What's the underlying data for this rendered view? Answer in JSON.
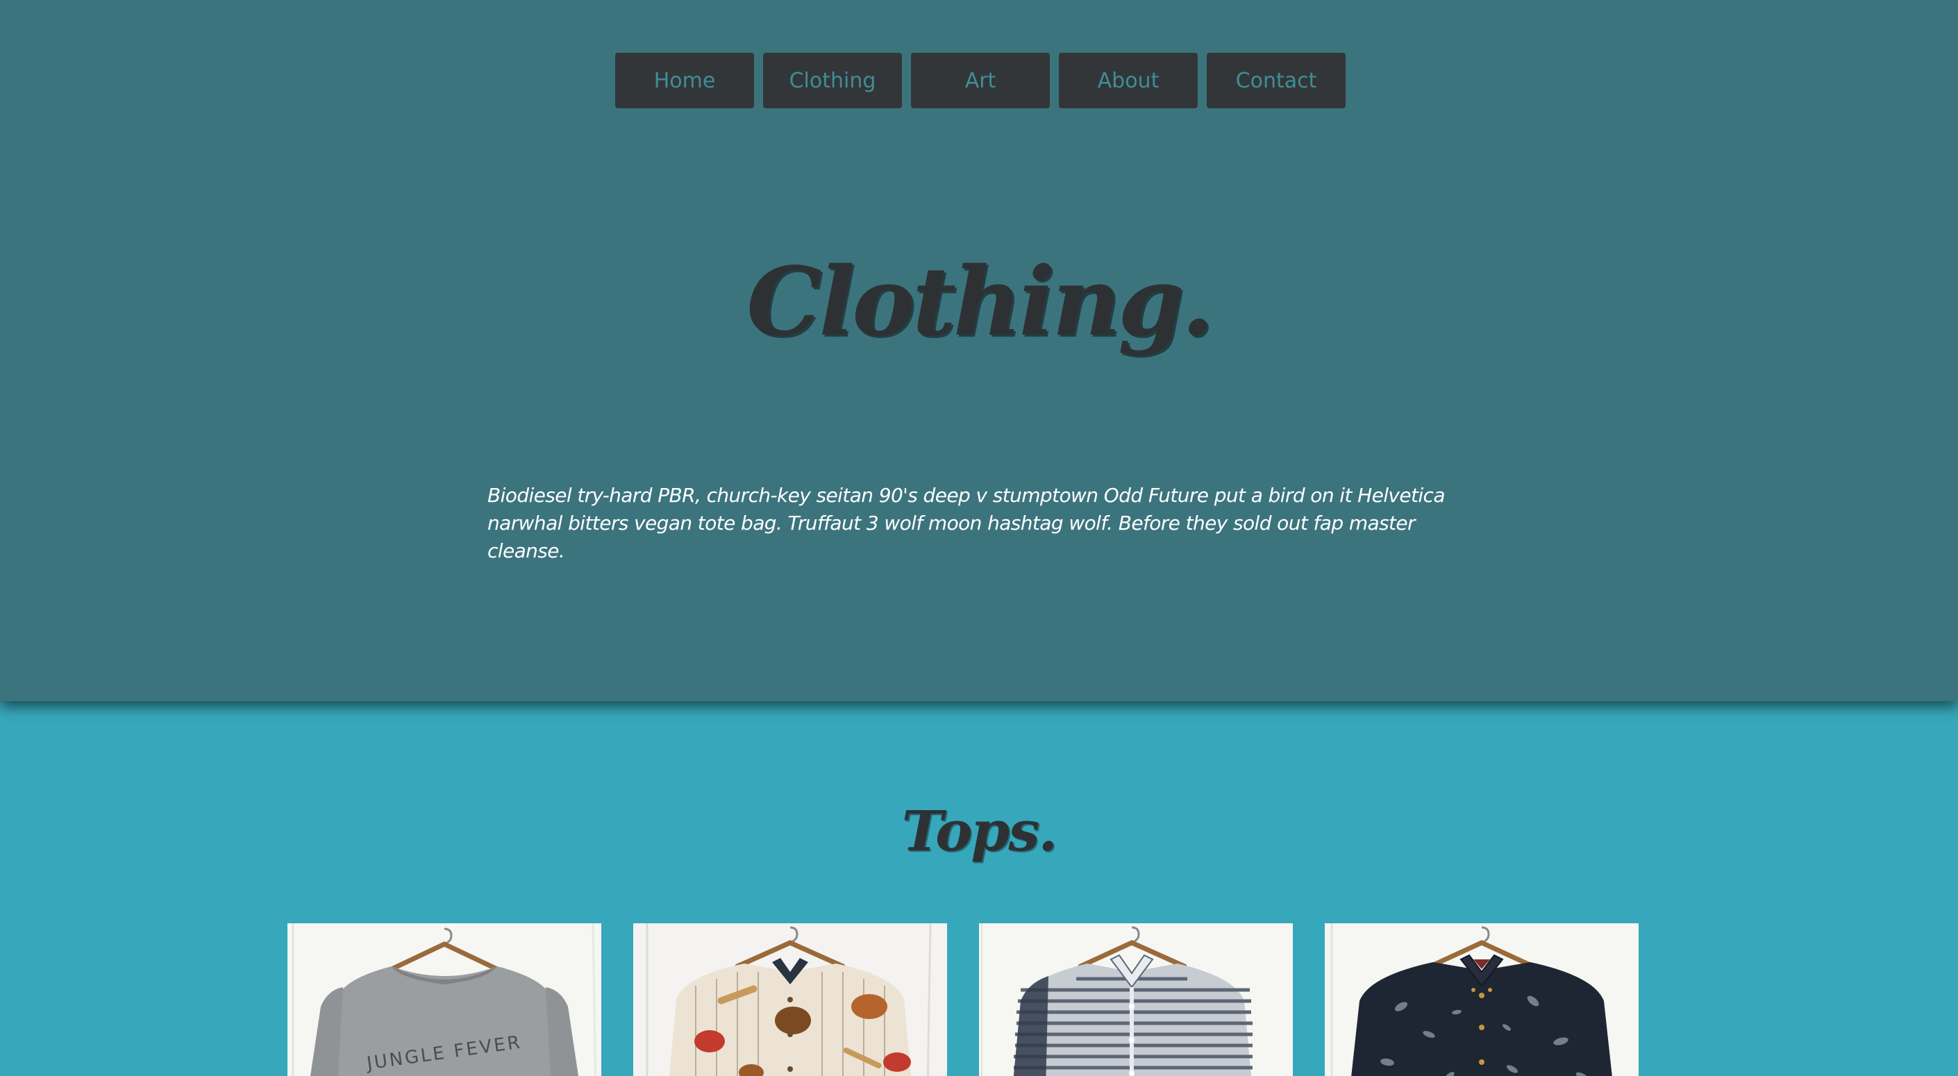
{
  "nav": {
    "items": [
      {
        "label": "Home",
        "name": "nav-home"
      },
      {
        "label": "Clothing",
        "name": "nav-clothing"
      },
      {
        "label": "Art",
        "name": "nav-art"
      },
      {
        "label": "About",
        "name": "nav-about"
      },
      {
        "label": "Contact",
        "name": "nav-contact"
      }
    ]
  },
  "hero": {
    "title": "Clothing.",
    "text": "Biodiesel try-hard PBR, church-key seitan 90's deep v stumptown Odd Future put a bird on it Helvetica narwhal bitters vegan tote bag. Truffaut 3 wolf moon hashtag wolf. Before they sold out fap master cleanse."
  },
  "tops": {
    "title": "Tops.",
    "products": [
      {
        "name": "grey-jungle-fever-sweatshirt",
        "print_text": "JUNGLE FEVER"
      },
      {
        "name": "baseball-print-shirt"
      },
      {
        "name": "grey-striped-shirt"
      },
      {
        "name": "navy-floral-shirt"
      }
    ]
  },
  "colors": {
    "hero_bg": "#3c747e",
    "tops_bg": "#37a7bb",
    "nav_bg": "#333638",
    "nav_text": "#3f8d98",
    "heading": "#2e3133"
  }
}
